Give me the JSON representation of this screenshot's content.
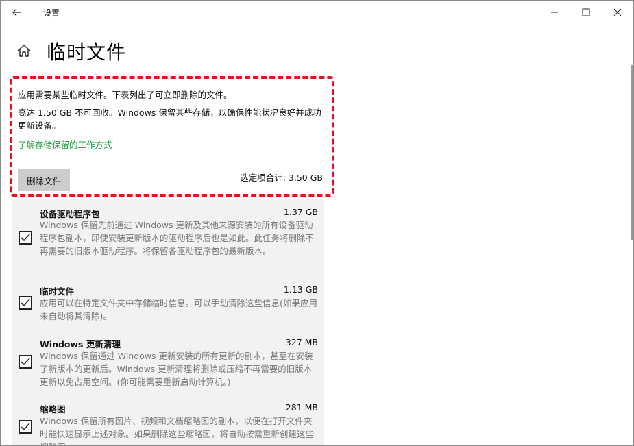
{
  "window": {
    "app_title": "设置"
  },
  "page": {
    "title": "临时文件"
  },
  "intro": {
    "line1": "应用需要某些临时文件。下表列出了可立即删除的文件。",
    "line2": "高达 1.50 GB 不可回收。Windows 保留某些存储，以确保性能状况良好并成功更新设备。",
    "learn_link": "了解存储保留的工作方式",
    "delete_button": "删除文件",
    "selected_total": "选定项合计: 3.50 GB"
  },
  "items": [
    {
      "title": "设备驱动程序包",
      "size": "1.37 GB",
      "description": "Windows 保留先前通过 Windows 更新及其他来源安装的所有设备驱动程序包副本，即使安装更新版本的驱动程序后也是如此。此任务将删除不再需要的旧版本驱动程序。将保留各驱动程序包的最新版本。",
      "checked": true
    },
    {
      "title": "临时文件",
      "size": "1.13 GB",
      "description": "应用可以在特定文件夹中存储临时信息。可以手动清除这些信息(如果应用未自动将其清除)。",
      "checked": true
    },
    {
      "title": "Windows 更新清理",
      "size": "327 MB",
      "description": "Windows 保留通过 Windows 更新安装的所有更新的副本，甚至在安装了新版本的更新后。Windows 更新清理将删除或压缩不再需要的旧版本更新以免占用空间。(你可能需要重新启动计算机。)",
      "checked": true
    },
    {
      "title": "缩略图",
      "size": "281 MB",
      "description": "Windows 保留所有图片、视频和文档缩略图的副本，以便在打开文件夹时能快速显示上述对象。如果删除这些缩略图，将自动按需重新创建这些缩略图。",
      "checked": true
    }
  ],
  "colors": {
    "highlight_border": "#e8121c",
    "link": "#1a9b3a",
    "list_background": "#f2f2f2"
  },
  "icons": {
    "back": "back-arrow-icon",
    "home": "home-icon",
    "minimize": "minimize-icon",
    "maximize": "maximize-icon",
    "close": "close-icon",
    "check": "checkmark-icon"
  }
}
